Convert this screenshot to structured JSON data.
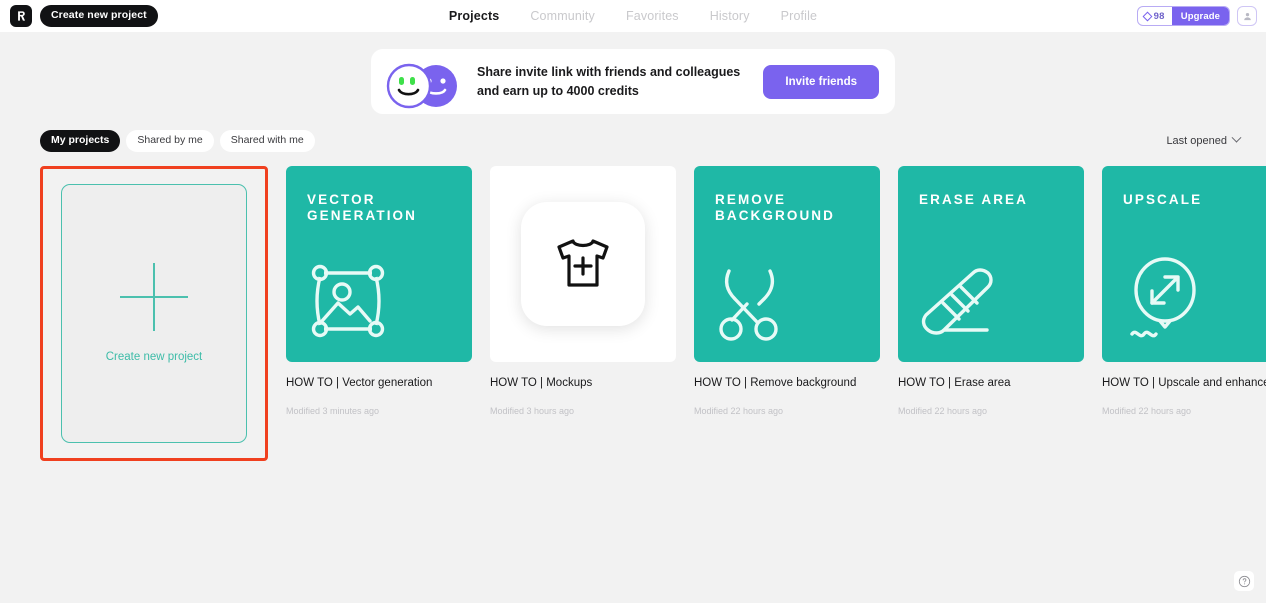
{
  "topbar": {
    "logo_icon": "app-logo-icon",
    "create_new_project_label": "Create new project",
    "nav": [
      {
        "label": "Projects",
        "active": true
      },
      {
        "label": "Community",
        "active": false
      },
      {
        "label": "Favorites",
        "active": false
      },
      {
        "label": "History",
        "active": false
      },
      {
        "label": "Profile",
        "active": false
      }
    ],
    "credits": {
      "icon": "diamond-icon",
      "count": "98"
    },
    "upgrade_label": "Upgrade",
    "avatar_icon": "user-avatar-icon"
  },
  "banner": {
    "faces_icon": "two-smiley-faces-icon",
    "text": "Share invite link with friends and colleagues and earn up to 4000 credits",
    "button_label": "Invite friends"
  },
  "filters": {
    "chips": [
      {
        "label": "My projects",
        "active": true
      },
      {
        "label": "Shared by me",
        "active": false
      },
      {
        "label": "Shared with me",
        "active": false
      }
    ],
    "sort_label": "Last opened",
    "sort_icon": "chevron-down-icon"
  },
  "new_project_card": {
    "icon": "plus-icon",
    "label": "Create new project",
    "highlighted": true,
    "highlight_color": "#f0401f",
    "border_color": "#4bc0ae"
  },
  "cards": [
    {
      "thumb_title": "VECTOR\nGENERATION",
      "thumb_style": "teal",
      "icon": "vector-image-nodes-icon",
      "title": "HOW TO | Vector generation",
      "meta": "Modified 3 minutes ago"
    },
    {
      "thumb_title": "",
      "thumb_style": "light",
      "icon": "tshirt-plus-icon",
      "title": "HOW TO | Mockups",
      "meta": "Modified 3 hours ago"
    },
    {
      "thumb_title": "REMOVE\nBACKGROUND",
      "thumb_style": "teal",
      "icon": "scissors-icon",
      "title": "HOW TO | Remove background",
      "meta": "Modified 22 hours ago"
    },
    {
      "thumb_title": "ERASE AREA",
      "thumb_style": "teal",
      "icon": "eraser-icon",
      "title": "HOW TO | Erase area",
      "meta": "Modified 22 hours ago"
    },
    {
      "thumb_title": "UPSCALE",
      "thumb_style": "teal",
      "icon": "balloon-resize-icon",
      "title": "HOW TO | Upscale and enhance",
      "meta": "Modified 22 hours ago"
    }
  ],
  "help": {
    "icon": "question-mark-icon"
  },
  "colors": {
    "teal": "#1fb8a6",
    "purple": "#7a63ee",
    "highlight_red": "#f0401f",
    "page_bg": "#f2f2f2"
  }
}
